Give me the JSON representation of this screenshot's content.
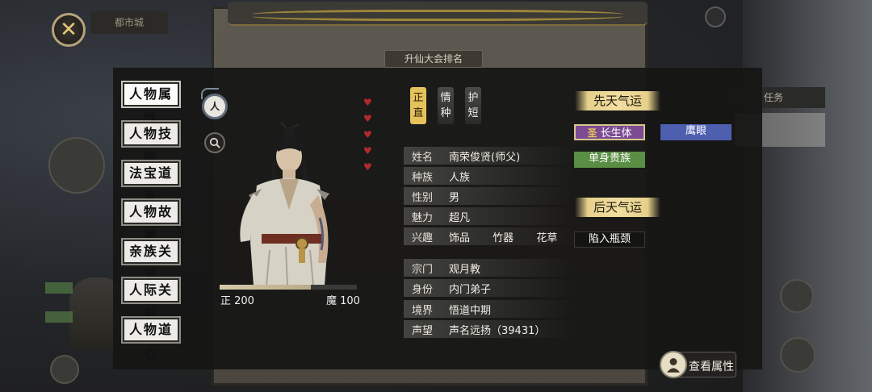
{
  "background": {
    "city_label": "都市城",
    "board_title": "升仙大会排名",
    "task_label": "任务"
  },
  "close_button": {
    "symbol": "✕"
  },
  "tabs": [
    {
      "label": "人物属性",
      "active": true
    },
    {
      "label": "人物技能",
      "active": false
    },
    {
      "label": "法宝道具",
      "active": false
    },
    {
      "label": "人物故事",
      "active": false
    },
    {
      "label": "亲族关系",
      "active": false
    },
    {
      "label": "人际关系",
      "active": false
    },
    {
      "label": "人物道心",
      "active": false
    }
  ],
  "icons": {
    "ren_badge": "人"
  },
  "morality": {
    "left_label": "正 200",
    "right_label": "魔 100",
    "fraction": 0.667
  },
  "hearts": {
    "count": 5,
    "color": "#b02a2a"
  },
  "traits": [
    {
      "line1": "正",
      "line2": "直",
      "style": "gold"
    },
    {
      "line1": "情",
      "line2": "种",
      "style": "grey"
    },
    {
      "line1": "护",
      "line2": "短",
      "style": "grey"
    }
  ],
  "info": {
    "name": {
      "label": "姓名",
      "value": "南荣俊贤(师父)"
    },
    "race": {
      "label": "种族",
      "value": "人族"
    },
    "gender": {
      "label": "性别",
      "value": "男"
    },
    "charm": {
      "label": "魅力",
      "value": "超凡"
    },
    "hobby": {
      "label": "兴趣",
      "values": [
        "饰品",
        "竹器",
        "花草"
      ]
    },
    "sect": {
      "label": "宗门",
      "value": "观月教"
    },
    "identity": {
      "label": "身份",
      "value": "内门弟子"
    },
    "realm": {
      "label": "境界",
      "value": "悟道中期"
    },
    "reputation": {
      "label": "声望",
      "value": "声名远扬（39431）"
    }
  },
  "innate_luck": {
    "title": "先天气运",
    "items": [
      {
        "label": "长生体",
        "seal": "圣",
        "color": "#7b4c92"
      },
      {
        "label": "鹰眼",
        "color": "#4e5fb0"
      },
      {
        "label": "单身贵族",
        "color": "#5a8e44"
      }
    ]
  },
  "acquired_luck": {
    "title": "后天气运",
    "items": [
      {
        "label": "陷入瓶颈",
        "color": "#141412"
      }
    ]
  },
  "view_attributes_button": {
    "label": "查看属性"
  }
}
